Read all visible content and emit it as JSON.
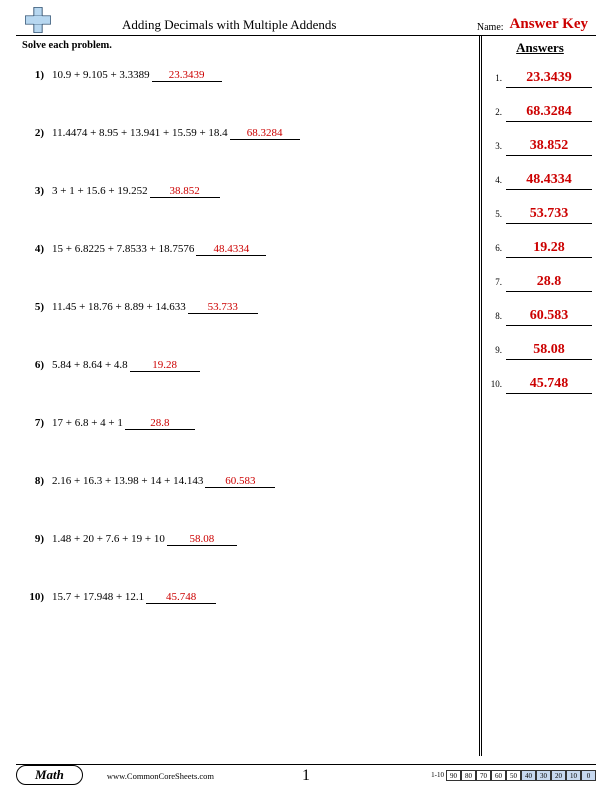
{
  "header": {
    "title": "Adding Decimals with Multiple Addends",
    "name_label": "Name:",
    "answer_key": "Answer Key"
  },
  "instruction": "Solve each problem.",
  "problems": [
    {
      "n": "1)",
      "expr": "10.9 + 9.105 + 3.3389",
      "ans": "23.3439"
    },
    {
      "n": "2)",
      "expr": "11.4474 + 8.95 + 13.941 + 15.59 + 18.4",
      "ans": "68.3284"
    },
    {
      "n": "3)",
      "expr": "3 + 1 + 15.6 + 19.252",
      "ans": "38.852"
    },
    {
      "n": "4)",
      "expr": "15 + 6.8225 + 7.8533 + 18.7576",
      "ans": "48.4334"
    },
    {
      "n": "5)",
      "expr": "11.45 + 18.76 + 8.89 + 14.633",
      "ans": "53.733"
    },
    {
      "n": "6)",
      "expr": "5.84 + 8.64 + 4.8",
      "ans": "19.28"
    },
    {
      "n": "7)",
      "expr": "17 + 6.8 + 4 + 1",
      "ans": "28.8"
    },
    {
      "n": "8)",
      "expr": "2.16 + 16.3 + 13.98 + 14 + 14.143",
      "ans": "60.583"
    },
    {
      "n": "9)",
      "expr": "1.48 + 20 + 7.6 + 19 + 10",
      "ans": "58.08"
    },
    {
      "n": "10)",
      "expr": "15.7 + 17.948 + 12.1",
      "ans": "45.748"
    }
  ],
  "answers_title": "Answers",
  "answers": [
    {
      "n": "1.",
      "val": "23.3439"
    },
    {
      "n": "2.",
      "val": "68.3284"
    },
    {
      "n": "3.",
      "val": "38.852"
    },
    {
      "n": "4.",
      "val": "48.4334"
    },
    {
      "n": "5.",
      "val": "53.733"
    },
    {
      "n": "6.",
      "val": "19.28"
    },
    {
      "n": "7.",
      "val": "28.8"
    },
    {
      "n": "8.",
      "val": "60.583"
    },
    {
      "n": "9.",
      "val": "58.08"
    },
    {
      "n": "10.",
      "val": "45.748"
    }
  ],
  "footer": {
    "subject": "Math",
    "site": "www.CommonCoreSheets.com",
    "page": "1",
    "score_label": "1-10",
    "scores": [
      "90",
      "80",
      "70",
      "60",
      "50",
      "40",
      "30",
      "20",
      "10",
      "0"
    ]
  }
}
